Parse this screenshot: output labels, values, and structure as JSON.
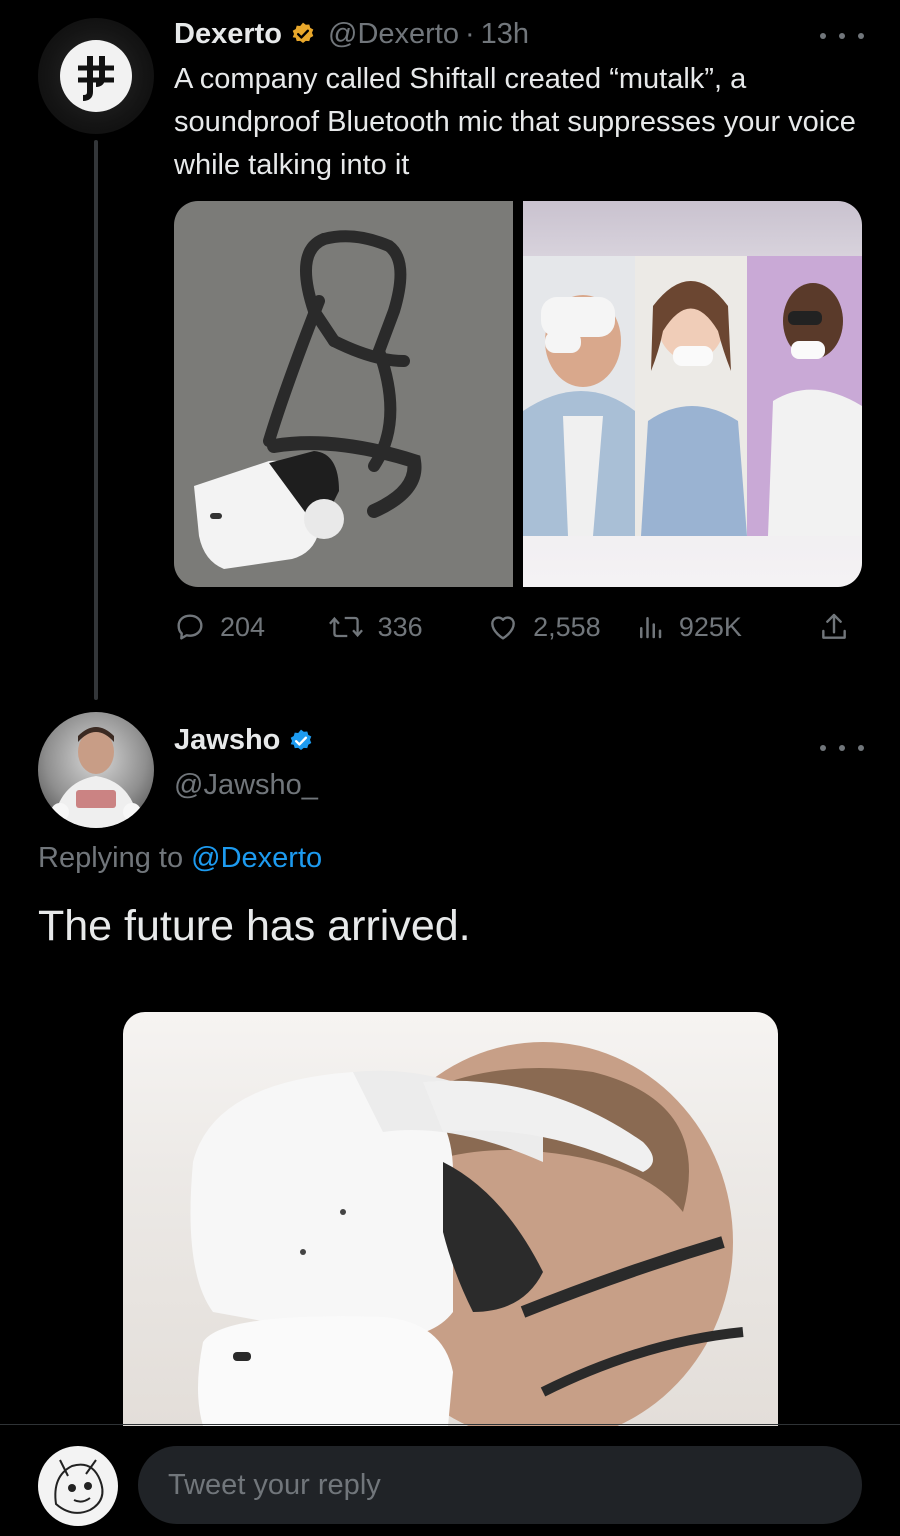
{
  "tweet": {
    "author_name": "Dexerto",
    "handle": "@Dexerto",
    "separator": "·",
    "time": "13h",
    "text": "A company called Shiftall created “mutalk”, a soundproof Bluetooth mic that suppresses your voice while talking into it",
    "verified_badge_color": "#e8a72b",
    "stats": {
      "replies": "204",
      "retweets": "336",
      "likes": "2,558",
      "views": "925K"
    }
  },
  "reply": {
    "author_name": "Jawsho",
    "handle": "@Jawsho_",
    "verified_badge_color": "#1d9bf0",
    "replying_prefix": "Replying to",
    "replying_to": "@Dexerto",
    "text": "The future has arrived."
  },
  "composer": {
    "placeholder": "Tweet your reply"
  },
  "colors": {
    "background": "#000000",
    "text_primary": "#e7e9ea",
    "text_secondary": "#71767b",
    "link": "#1d9bf0",
    "input_bg": "#202327"
  },
  "icons": [
    "more-icon",
    "reply-icon",
    "retweet-icon",
    "like-icon",
    "views-icon",
    "share-icon",
    "verified-badge-icon"
  ]
}
